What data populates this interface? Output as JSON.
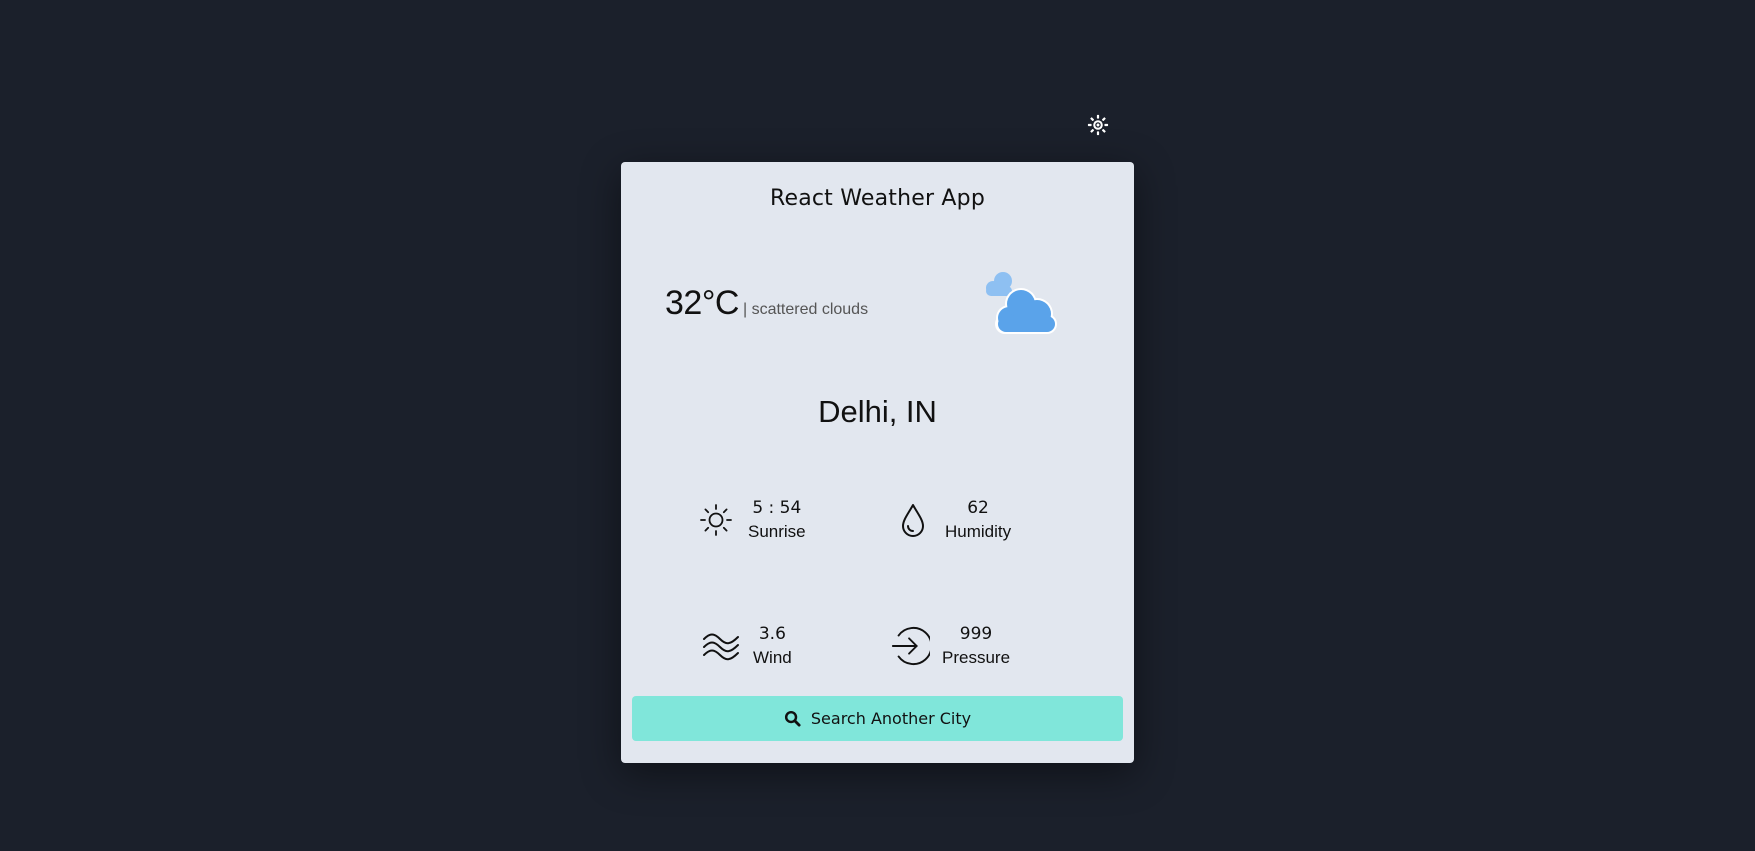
{
  "header": {
    "theme_toggle_icon": "sun-gear-icon"
  },
  "card": {
    "title": "React Weather App",
    "temperature": "32°C",
    "description": "| scattered clouds",
    "weather_icon": "cloud-icon",
    "city": "Delhi, IN",
    "stats": {
      "sunrise": {
        "value": "5 : 54",
        "label": "Sunrise",
        "icon": "sun-icon"
      },
      "humidity": {
        "value": "62",
        "label": "Humidity",
        "icon": "droplet-icon"
      },
      "wind": {
        "value": "3.6",
        "label": "Wind",
        "icon": "wind-waves-icon"
      },
      "pressure": {
        "value": "999",
        "label": "Pressure",
        "icon": "arrow-in-circle-icon"
      }
    },
    "search_button": {
      "label": "Search Another City",
      "icon": "search-icon"
    }
  },
  "colors": {
    "background": "#1b202b",
    "card": "#e2e7ef",
    "button": "#80e6da",
    "cloud": "#5aa3ea",
    "cloud_back": "#8ec0f2"
  }
}
